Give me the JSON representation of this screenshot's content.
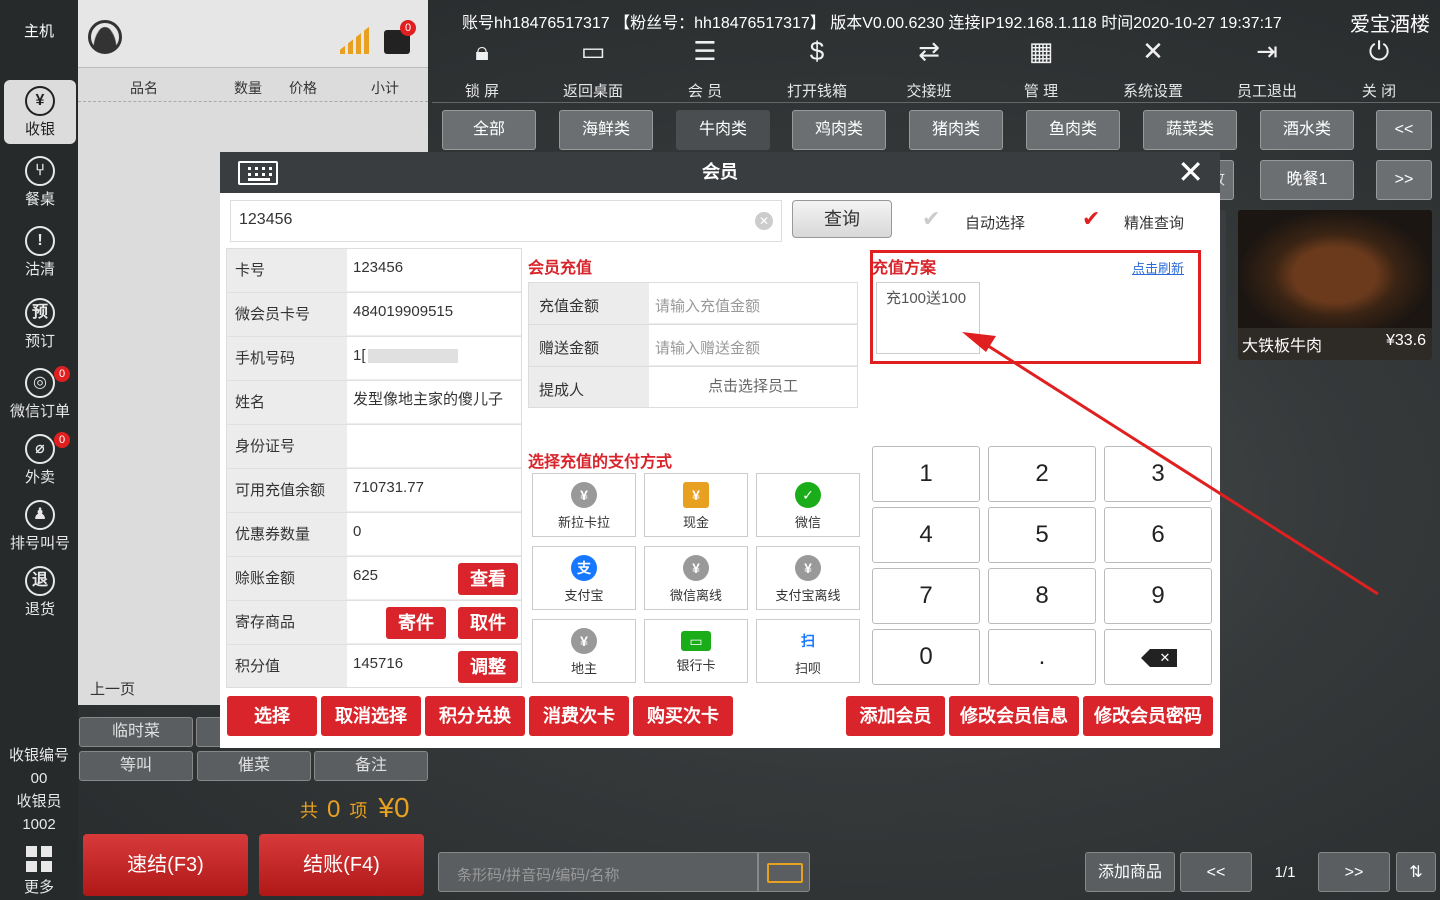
{
  "nav": {
    "host": "主机",
    "items": [
      {
        "label": "收银",
        "icon": "¥"
      },
      {
        "label": "餐桌",
        "icon": "⑂"
      },
      {
        "label": "沽清",
        "icon": "!"
      },
      {
        "label": "预订",
        "icon": "预"
      },
      {
        "label": "微信订单",
        "icon": "◎",
        "badge": "0"
      },
      {
        "label": "外卖",
        "icon": "⌀",
        "badge": "0"
      },
      {
        "label": "排号叫号",
        "icon": "♟"
      },
      {
        "label": "退货",
        "icon": "退"
      }
    ],
    "cashier_no_label": "收银编号",
    "cashier_no": "00",
    "cashier_label": "收银员",
    "cashier": "1002",
    "more": "更多"
  },
  "receipt": {
    "printer_badge": "0",
    "columns": [
      "品名",
      "数量",
      "价格",
      "小计"
    ],
    "prev_page": "上一页",
    "buttons": [
      "临时菜",
      "等叫",
      "催菜",
      "备注"
    ],
    "total_prefix": "共",
    "total_count": "0",
    "total_unit": "项",
    "total_amount": "¥0"
  },
  "actions": {
    "quick": "速结(F3)",
    "checkout": "结账(F4)"
  },
  "header": {
    "info": "账号hh18476517317 【粉丝号：hh18476517317】 版本V0.00.6230 连接IP192.168.1.118 时间2020-10-27 19:37:17",
    "store": "爱宝酒楼",
    "tools": [
      "锁 屏",
      "返回桌面",
      "会 员",
      "打开钱箱",
      "交接班",
      "管 理",
      "系统设置",
      "员工退出",
      "关 闭"
    ]
  },
  "categories": [
    "全部",
    "海鲜类",
    "牛肉类",
    "鸡肉类",
    "猪肉类",
    "鱼肉类",
    "蔬菜类",
    "酒水类"
  ],
  "row2": {
    "partial": "敢",
    "dinner": "晚餐1"
  },
  "product": {
    "name": "大铁板牛肉",
    "price": "¥33.6"
  },
  "dialog": {
    "title": "会员",
    "search_value": "123456",
    "query": "查询",
    "auto_select": "自动选择",
    "exact_query": "精准查询",
    "fields": [
      {
        "label": "卡号",
        "value": "123456"
      },
      {
        "label": "微会员卡号",
        "value": "484019909515"
      },
      {
        "label": "手机号码",
        "value": "1["
      },
      {
        "label": "姓名",
        "value": "发型像地主家的傻儿子"
      },
      {
        "label": "身份证号",
        "value": ""
      },
      {
        "label": "可用充值余额",
        "value": "710731.77"
      },
      {
        "label": "优惠券数量",
        "value": "0"
      },
      {
        "label": "赊账金额",
        "value": "625"
      },
      {
        "label": "寄存商品",
        "value": ""
      },
      {
        "label": "积分值",
        "value": "145716"
      }
    ],
    "field_buttons": {
      "view": "查看",
      "deposit": "寄件",
      "pickup": "取件",
      "adjust": "调整"
    },
    "recharge_title": "会员充值",
    "recharge_amount_label": "充值金额",
    "recharge_amount_ph": "请输入充值金额",
    "gift_amount_label": "赠送金额",
    "gift_amount_ph": "请输入赠送金额",
    "commission_label": "提成人",
    "commission_ph": "点击选择员工",
    "plan_title": "充值方案",
    "refresh": "点击刷新",
    "plan_item": "充100送100",
    "pay_title": "选择充值的支付方式",
    "pays": [
      {
        "label": "新拉卡拉",
        "icon": "¥"
      },
      {
        "label": "现金",
        "icon": "¥"
      },
      {
        "label": "微信",
        "icon": "✓"
      },
      {
        "label": "支付宝",
        "icon": "支"
      },
      {
        "label": "微信离线",
        "icon": "¥"
      },
      {
        "label": "支付宝离线",
        "icon": "¥"
      },
      {
        "label": "地主",
        "icon": "¥"
      },
      {
        "label": "银行卡",
        "icon": "▭"
      },
      {
        "label": "扫呗",
        "icon": "扫"
      }
    ],
    "keys": [
      "1",
      "2",
      "3",
      "4",
      "5",
      "6",
      "7",
      "8",
      "9",
      "0",
      "."
    ],
    "bottom_buttons": [
      "选择",
      "取消选择",
      "积分兑换",
      "消费次卡",
      "购买次卡",
      "添加会员",
      "修改会员信息",
      "修改会员密码"
    ]
  },
  "bottom": {
    "barcode_ph": "条形码/拼音码/编码/名称",
    "add_product": "添加商品",
    "page": "1/1"
  },
  "colors": {
    "accent_red": "#d8242a",
    "dark_bg": "#2b2e2f"
  }
}
